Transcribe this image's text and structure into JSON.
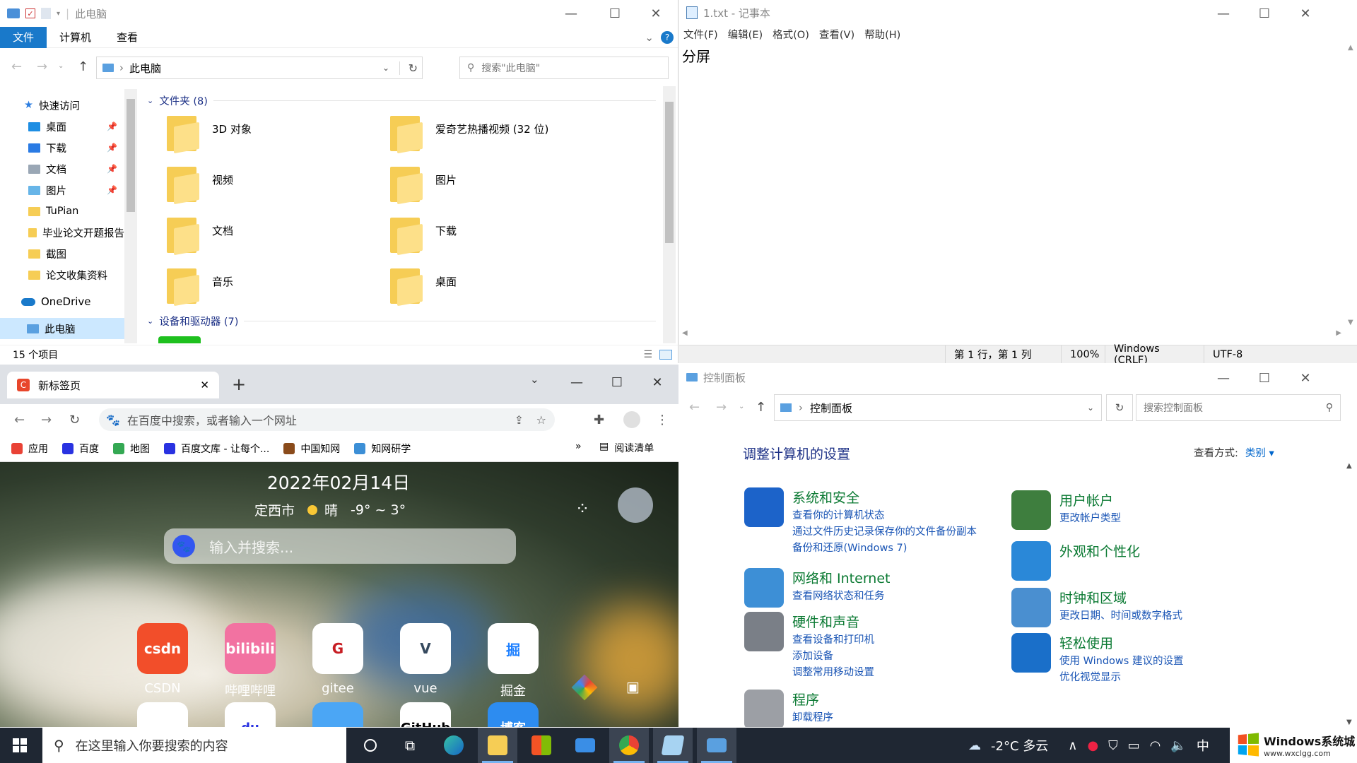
{
  "explorer": {
    "title": "此电脑",
    "tabs": [
      "文件",
      "计算机",
      "查看"
    ],
    "address": "此电脑",
    "search_placeholder": "搜索\"此电脑\"",
    "quick_access": "快速访问",
    "nav": [
      {
        "label": "桌面",
        "pinned": true,
        "color": "#1e8ee3"
      },
      {
        "label": "下载",
        "pinned": true,
        "color": "#2a7be4"
      },
      {
        "label": "文档",
        "pinned": true,
        "color": "#9aa7b5"
      },
      {
        "label": "图片",
        "pinned": true,
        "color": "#67b5e8"
      },
      {
        "label": "TuPian",
        "pinned": false,
        "color": "#f6cd55"
      },
      {
        "label": "毕业论文开题报告",
        "pinned": false,
        "color": "#f6cd55"
      },
      {
        "label": "截图",
        "pinned": false,
        "color": "#f6cd55"
      },
      {
        "label": "论文收集资料",
        "pinned": false,
        "color": "#f6cd55"
      }
    ],
    "onedrive": "OneDrive",
    "this_pc": "此电脑",
    "folders_group": "文件夹 (8)",
    "folders": [
      {
        "label": "3D 对象",
        "emblem": "#6ec7f0"
      },
      {
        "label": "爱奇艺热播视频 (32 位)",
        "emblem": "#1fbd35"
      },
      {
        "label": "视频",
        "emblem": "#4b4b4b"
      },
      {
        "label": "图片",
        "emblem": "#8fc4ea"
      },
      {
        "label": "文档",
        "emblem": "#e8eef4"
      },
      {
        "label": "下载",
        "emblem": "#2b7de0"
      },
      {
        "label": "音乐",
        "emblem": "#2a8ae0"
      },
      {
        "label": "桌面",
        "emblem": "#1e8ee3"
      }
    ],
    "devices_group": "设备和驱动器 (7)",
    "status": "15 个项目"
  },
  "notepad": {
    "title": "1.txt - 记事本",
    "menu": [
      "文件(F)",
      "编辑(E)",
      "格式(O)",
      "查看(V)",
      "帮助(H)"
    ],
    "content": "分屏",
    "status": [
      "第 1 行，第 1 列",
      "100%",
      "Windows (CRLF)",
      "UTF-8"
    ]
  },
  "chrome": {
    "tab_title": "新标签页",
    "url_placeholder": "在百度中搜索，或者输入一个网址",
    "bookmarks": [
      {
        "label": "应用",
        "color": "#e94235"
      },
      {
        "label": "百度",
        "color": "#2932e1"
      },
      {
        "label": "地图",
        "color": "#34a853"
      },
      {
        "label": "百度文库 - 让每个...",
        "color": "#2932e1"
      },
      {
        "label": "中国知网",
        "color": "#8a4b1b"
      },
      {
        "label": "知网研学",
        "color": "#3c8fd6"
      }
    ],
    "reading_list": "阅读清单",
    "date": "2022年02月14日",
    "city": "定西市",
    "weather": "晴",
    "temp": "-9° ~ 3°",
    "search_placeholder": "输入并搜索...",
    "shortcuts": [
      {
        "label": "CSDN",
        "text": "csdn",
        "bg": "#f24e2a",
        "fg": "#ffffff"
      },
      {
        "label": "哔哩哔哩",
        "text": "bilibili",
        "bg": "#f272a1",
        "fg": "#ffffff"
      },
      {
        "label": "gitee",
        "text": "G",
        "bg": "#ffffff",
        "fg": "#c71d23"
      },
      {
        "label": "vue",
        "text": "V",
        "bg": "#ffffff",
        "fg": "#35495e"
      },
      {
        "label": "掘金",
        "text": "掘",
        "bg": "#ffffff",
        "fg": "#1e80ff"
      }
    ],
    "shortcuts_row2": [
      {
        "text": "",
        "bg": "#ffffff",
        "fg": "#2ea77a"
      },
      {
        "text": "du",
        "bg": "#ffffff",
        "fg": "#2932e1"
      },
      {
        "text": "",
        "bg": "#4ba6f5",
        "fg": "#ffffff"
      },
      {
        "text": "GitHub",
        "bg": "#ffffff",
        "fg": "#000000"
      },
      {
        "text": "博客",
        "bg": "#2d8cf0",
        "fg": "#ffffff"
      }
    ]
  },
  "control_panel": {
    "title": "控制面板",
    "address": "控制面板",
    "search_placeholder": "搜索控制面板",
    "heading": "调整计算机的设置",
    "view_by_label": "查看方式:",
    "view_by_value": "类别 ▾",
    "left": [
      {
        "title": "系统和安全",
        "links": [
          "查看你的计算机状态",
          "通过文件历史记录保存你的文件备份副本",
          "备份和还原(Windows 7)"
        ],
        "color": "#1c63c9"
      },
      {
        "title": "网络和 Internet",
        "links": [
          "查看网络状态和任务"
        ],
        "color": "#3d8fd6"
      },
      {
        "title": "硬件和声音",
        "links": [
          "查看设备和打印机",
          "添加设备",
          "调整常用移动设置"
        ],
        "color": "#7a7f87"
      },
      {
        "title": "程序",
        "links": [
          "卸载程序"
        ],
        "color": "#9c9fa5"
      }
    ],
    "right": [
      {
        "title": "用户帐户",
        "links": [
          "更改帐户类型"
        ],
        "color": "#3e7e3e"
      },
      {
        "title": "外观和个性化",
        "links": [],
        "color": "#2a88d8"
      },
      {
        "title": "时钟和区域",
        "links": [
          "更改日期、时间或数字格式"
        ],
        "color": "#4a8fd0"
      },
      {
        "title": "轻松使用",
        "links": [
          "使用 Windows 建议的设置",
          "优化视觉显示"
        ],
        "color": "#1a6fc9"
      }
    ]
  },
  "taskbar": {
    "search_placeholder": "在这里输入你要搜索的内容",
    "weather": "-2°C 多云",
    "ime": "中"
  },
  "watermark": {
    "line1": "Windows系统城",
    "line2": "www.wxclgg.com"
  }
}
